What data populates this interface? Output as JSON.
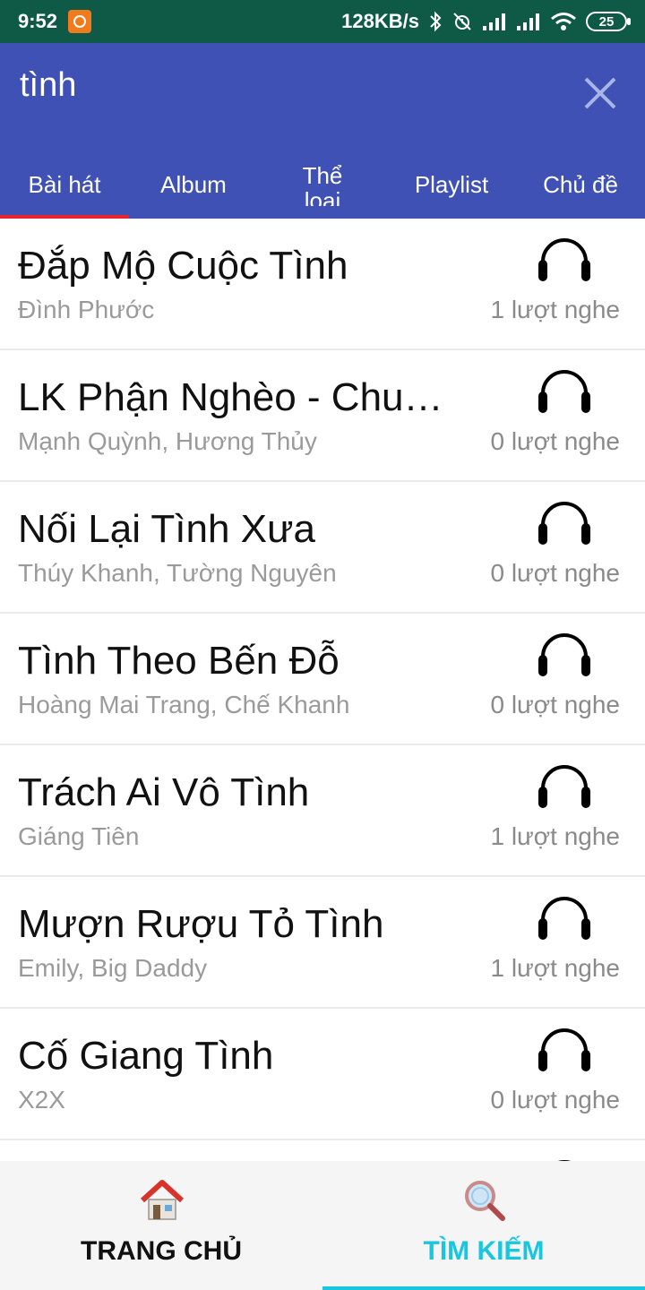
{
  "status_bar": {
    "time": "9:52",
    "network_speed": "128KB/s",
    "battery_level": "25",
    "icons": [
      "mi-app-icon",
      "bluetooth-icon",
      "alarm-off-icon",
      "signal-icon",
      "signal-icon",
      "wifi-icon",
      "battery-icon"
    ]
  },
  "search": {
    "query": "tình",
    "close_icon": "close-icon"
  },
  "tabs": [
    {
      "label": "Bài hát",
      "active": true
    },
    {
      "label": "Album",
      "active": false
    },
    {
      "label": "Thể loại",
      "active": false
    },
    {
      "label": "Playlist",
      "active": false
    },
    {
      "label": "Chủ đề",
      "active": false
    }
  ],
  "songs": [
    {
      "title": "Đắp Mộ Cuộc Tình",
      "artist": "Đình Phước",
      "plays": "1 lượt nghe"
    },
    {
      "title": "LK Phận Nghèo - Chuyện Tình Không Dĩ Vãng",
      "artist": "Mạnh Quỳnh, Hương Thủy",
      "plays": "0 lượt nghe"
    },
    {
      "title": "Nối Lại Tình Xưa",
      "artist": "Thúy Khanh, Tường Nguyên",
      "plays": "0 lượt nghe"
    },
    {
      "title": "Tình Theo Bến Đỗ",
      "artist": "Hoàng Mai Trang, Chế Khanh",
      "plays": "0 lượt nghe"
    },
    {
      "title": "Trách Ai Vô Tình",
      "artist": "Giáng Tiên",
      "plays": "1 lượt nghe"
    },
    {
      "title": "Mượn Rượu Tỏ Tình",
      "artist": "Emily, Big Daddy",
      "plays": "1 lượt nghe"
    },
    {
      "title": "Cố Giang Tình",
      "artist": "X2X",
      "plays": "0 lượt nghe"
    }
  ],
  "bottom_nav": {
    "home_label": "TRANG CHỦ",
    "search_label": "TÌM KIẾM",
    "active": "search"
  },
  "colors": {
    "status_bar": "#0f5a46",
    "app_bar": "#3f51b5",
    "tab_indicator": "#e8232f",
    "active_nav": "#19c6de"
  }
}
